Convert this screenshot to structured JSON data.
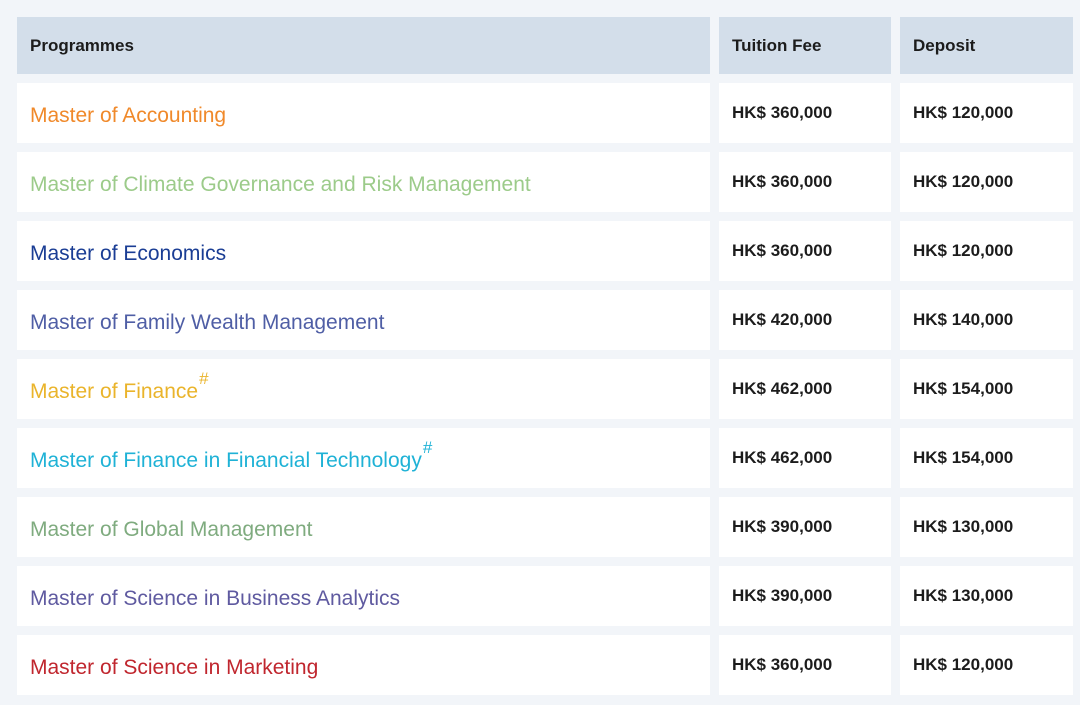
{
  "table": {
    "headers": {
      "programmes": "Programmes",
      "tuition_fee": "Tuition Fee",
      "deposit": "Deposit"
    },
    "rows": [
      {
        "programme": "Master of Accounting",
        "mark": "",
        "color": "#f0892a",
        "tuition_fee": "HK$ 360,000",
        "deposit": "HK$ 120,000"
      },
      {
        "programme": "Master of Climate Governance and Risk Management",
        "mark": "",
        "color": "#9ccb8a",
        "tuition_fee": "HK$ 360,000",
        "deposit": "HK$ 120,000"
      },
      {
        "programme": "Master of Economics",
        "mark": "",
        "color": "#1a3d94",
        "tuition_fee": "HK$ 360,000",
        "deposit": "HK$ 120,000"
      },
      {
        "programme": "Master of Family Wealth Management",
        "mark": "",
        "color": "#4f5ea5",
        "tuition_fee": "HK$ 420,000",
        "deposit": "HK$ 140,000"
      },
      {
        "programme": "Master of Finance",
        "mark": "#",
        "color": "#eab42b",
        "tuition_fee": "HK$ 462,000",
        "deposit": "HK$ 154,000"
      },
      {
        "programme": "Master of Finance in Financial Technology",
        "mark": "#",
        "color": "#1fb2d6",
        "tuition_fee": "HK$ 462,000",
        "deposit": "HK$ 154,000"
      },
      {
        "programme": "Master of Global Management",
        "mark": "",
        "color": "#7fab7f",
        "tuition_fee": "HK$ 390,000",
        "deposit": "HK$ 130,000"
      },
      {
        "programme": "Master of Science in Business Analytics",
        "mark": "",
        "color": "#5f5aa0",
        "tuition_fee": "HK$ 390,000",
        "deposit": "HK$ 130,000"
      },
      {
        "programme": "Master of Science in Marketing",
        "mark": "",
        "color": "#c0262e",
        "tuition_fee": "HK$ 360,000",
        "deposit": "HK$ 120,000"
      }
    ]
  }
}
